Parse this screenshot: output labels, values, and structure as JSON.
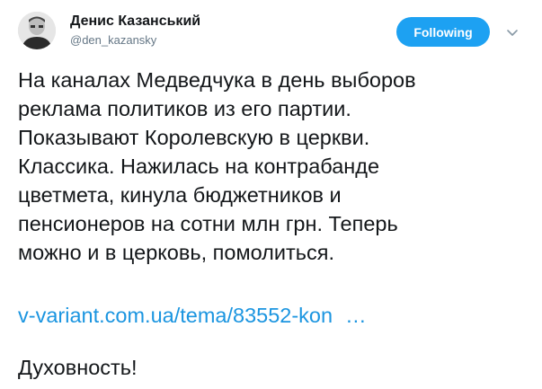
{
  "user": {
    "display_name": "Денис Казанський",
    "handle": "@den_kazansky",
    "avatar_icon": "profile-photo"
  },
  "actions": {
    "follow_label": "Following",
    "menu_icon": "chevron-down-icon"
  },
  "tweet": {
    "lines": [
      "На каналах Медведчука в день выборов",
      "реклама политиков из его партии.",
      "Показывают Королевскую в церкви.",
      "Классика. Нажилась на контрабанде",
      "цветмета, кинула бюджетников и",
      "пенсионеров на сотни млн грн. Теперь",
      "можно и в церковь, помолиться."
    ],
    "link_text": "v-variant.com.ua/tema/83552-kon",
    "link_ellipsis": "…",
    "closing": "Духовность!"
  },
  "colors": {
    "follow_button_bg": "#1da1f2",
    "link": "#1b95e0",
    "text": "#14171a",
    "secondary_text": "#657786"
  }
}
